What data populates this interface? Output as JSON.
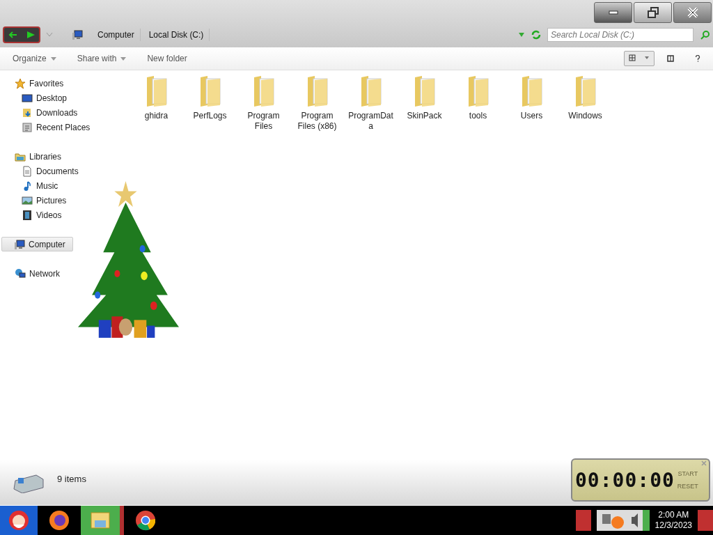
{
  "window_controls": [
    {
      "kind": "minimize",
      "hovered": true
    },
    {
      "kind": "restore",
      "hovered": false
    },
    {
      "kind": "close",
      "hovered": false
    }
  ],
  "address_bar": {
    "crumbs": [
      "Computer",
      "Local Disk (C:)"
    ]
  },
  "search": {
    "placeholder": "Search Local Disk (C:)"
  },
  "toolbar": [
    {
      "label": "Organize",
      "menu": true
    },
    {
      "label": "Share with",
      "menu": true
    },
    {
      "label": "New folder",
      "menu": false
    }
  ],
  "sidebar": [
    {
      "label": "Favorites",
      "kind": "star",
      "selected": false,
      "children": [
        {
          "label": "Desktop",
          "kind": "desktop"
        },
        {
          "label": "Downloads",
          "kind": "downloads"
        },
        {
          "label": "Recent Places",
          "kind": "recent"
        }
      ]
    },
    {
      "label": "Libraries",
      "kind": "library",
      "selected": false,
      "children": [
        {
          "label": "Documents",
          "kind": "document"
        },
        {
          "label": "Music",
          "kind": "music"
        },
        {
          "label": "Pictures",
          "kind": "pictures"
        },
        {
          "label": "Videos",
          "kind": "videos"
        }
      ]
    },
    {
      "label": "Computer",
      "kind": "computer",
      "selected": true
    },
    {
      "label": "Network",
      "kind": "network",
      "selected": false
    }
  ],
  "folders": [
    {
      "name": "ghidra"
    },
    {
      "name": "PerfLogs"
    },
    {
      "name": "Program Files"
    },
    {
      "name": "Program Files (x86)"
    },
    {
      "name": "ProgramData"
    },
    {
      "name": "SkinPack"
    },
    {
      "name": "tools"
    },
    {
      "name": "Users"
    },
    {
      "name": "Windows"
    }
  ],
  "status_bar": {
    "text": "9 items"
  },
  "stopwatch": {
    "time": "00:00:00",
    "buttons": [
      "START",
      "RESET"
    ]
  },
  "taskbar": {
    "apps": [
      {
        "kind": "start",
        "selected": false
      },
      {
        "kind": "firefox",
        "selected": false
      },
      {
        "kind": "explorer",
        "selected": true
      },
      {
        "kind": "chrome",
        "selected": false
      }
    ],
    "time": "2:00 AM",
    "date": "12/3/2023"
  }
}
